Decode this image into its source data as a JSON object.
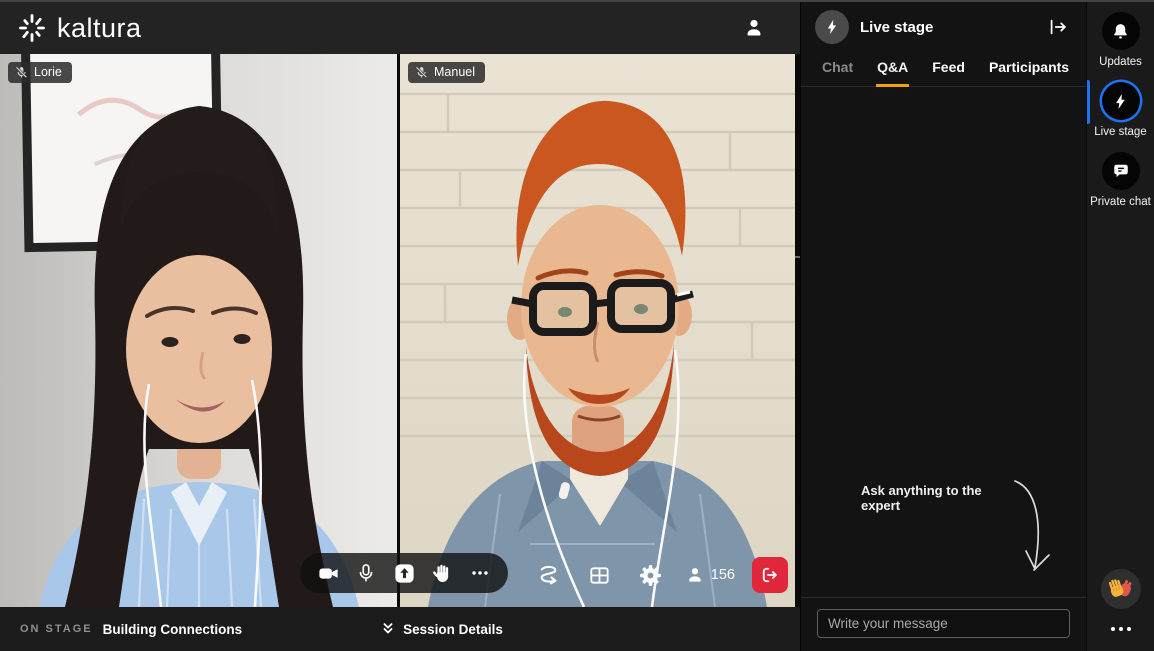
{
  "topbar": {
    "brand": "kaltura"
  },
  "stage": {
    "tiles": [
      {
        "name": "Lorie",
        "muted": true
      },
      {
        "name": "Manuel",
        "muted": true
      }
    ],
    "attendee_count": "156"
  },
  "bottombar": {
    "stage_label": "ON STAGE",
    "session_title": "Building Connections",
    "details_label": "Session Details"
  },
  "panel": {
    "title": "Live stage",
    "tabs": [
      {
        "label": "Chat",
        "active": false
      },
      {
        "label": "Q&A",
        "active": true
      },
      {
        "label": "Feed",
        "active": false
      },
      {
        "label": "Participants",
        "active": false
      }
    ],
    "empty_hint": "Ask anything to the expert",
    "composer_placeholder": "Write your message"
  },
  "rail": {
    "items": [
      {
        "label": "Updates",
        "active": false
      },
      {
        "label": "Live stage",
        "active": true
      },
      {
        "label": "Private chat",
        "active": false
      }
    ]
  },
  "colors": {
    "accent_orange": "#f2a20d",
    "accent_blue": "#1b74f0",
    "leave_red": "#e0273b"
  }
}
